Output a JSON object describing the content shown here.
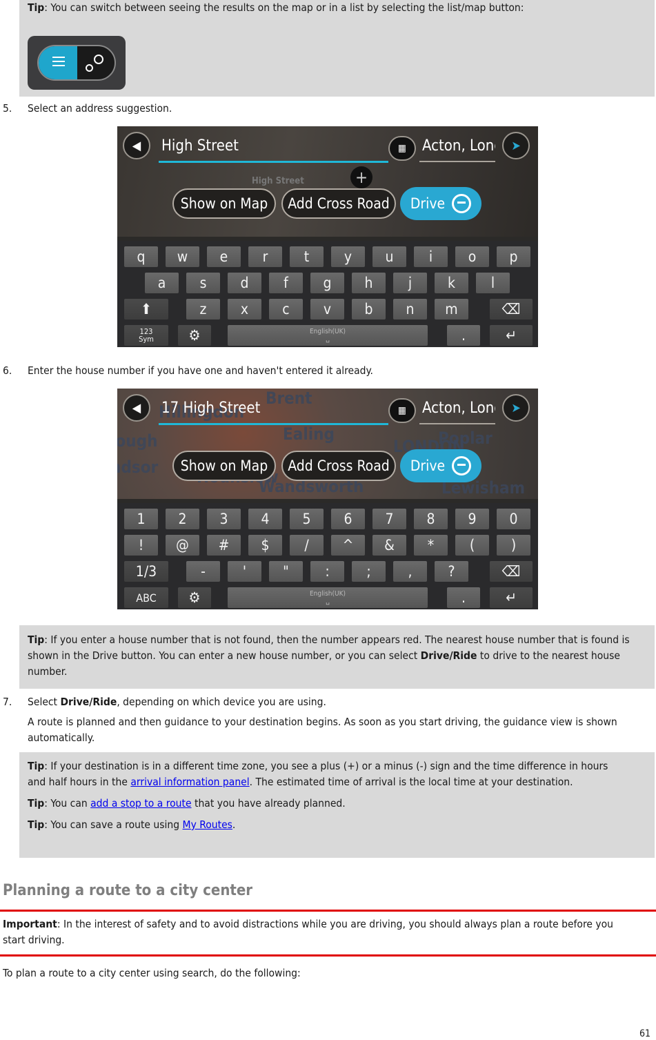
{
  "tip_top": {
    "label": "Tip",
    "text": ": You can switch between seeing the results on the map or in a list by selecting the list/map button:",
    "button_icons": [
      "list-icon",
      "map-pins-icon"
    ]
  },
  "step5": {
    "number": "5.",
    "text": "Select an address suggestion."
  },
  "screen1": {
    "query": "High Street",
    "city": "Acton, Lond",
    "map_label": "High Street",
    "buttons": {
      "show_on_map": "Show on Map",
      "add_cross_road": "Add Cross Road",
      "drive": "Drive"
    },
    "keyboard": {
      "row1": [
        "q",
        "w",
        "e",
        "r",
        "t",
        "y",
        "u",
        "i",
        "o",
        "p"
      ],
      "row2": [
        "a",
        "s",
        "d",
        "f",
        "g",
        "h",
        "j",
        "k",
        "l"
      ],
      "row3": [
        "z",
        "x",
        "c",
        "v",
        "b",
        "n",
        "m"
      ],
      "sym_label_1": "123",
      "sym_label_2": "Sym",
      "space_label": "English(UK)",
      "period": "."
    }
  },
  "step6": {
    "number": "6.",
    "text": "Enter the house number if you have one and haven't entered it already."
  },
  "screen2": {
    "query": "17 High Street",
    "city": "Acton, Londo",
    "map_labels": [
      "Brent",
      "Hillingdon",
      "Ealing",
      "LONDON",
      "Poplar",
      "lough",
      "ndsor",
      "Hounslow",
      "Wandsworth",
      "Lewisham"
    ],
    "buttons": {
      "show_on_map": "Show on Map",
      "add_cross_road": "Add Cross Road",
      "drive": "Drive"
    },
    "keyboard": {
      "row1": [
        "1",
        "2",
        "3",
        "4",
        "5",
        "6",
        "7",
        "8",
        "9",
        "0"
      ],
      "row2": [
        "!",
        "@",
        "#",
        "$",
        "/",
        "^",
        "&",
        "*",
        "(",
        ")"
      ],
      "row3": [
        "-",
        "'",
        "\"",
        ":",
        ";",
        ",",
        "?"
      ],
      "page_label": "1/3",
      "abc_label": "ABC",
      "space_label": "English(UK)",
      "period": "."
    }
  },
  "tip_house": {
    "label": "Tip",
    "text_before": ": If you enter a house number that is not found, then the number appears red. The nearest house number that is found is shown in the Drive button. You can enter a new house number, or you can select ",
    "bold": "Drive/Ride",
    "text_after": " to drive to the nearest house number."
  },
  "step7": {
    "number": "7.",
    "text_before": "Select ",
    "bold": "Drive/Ride",
    "text_after": ", depending on which device you are using.",
    "para": "A route is planned and then guidance to your destination begins. As soon as you start driving, the guidance view is shown automatically."
  },
  "tips_route": [
    {
      "label": "Tip",
      "before": ": If your destination is in a different time zone, you see a plus (+) or a minus (-) sign and the time difference in hours and half hours in the ",
      "link": "arrival information panel",
      "after": ". The estimated time of arrival is the local time at your destination."
    },
    {
      "label": "Tip",
      "before": ": You can ",
      "link": "add a stop to a route",
      "after": " that you have already planned."
    },
    {
      "label": "Tip",
      "before": ": You can save a route using ",
      "link": "My Routes",
      "after": "."
    }
  ],
  "section": {
    "heading": "Planning a route to a city center",
    "important_label": "Important",
    "important_text": ": In the interest of safety and to avoid distractions while you are driving, you should always plan a route before you start driving.",
    "intro": "To plan a route to a city center using search, do the following:"
  },
  "page_number": "61",
  "colors": {
    "accent": "#29a8d2",
    "tip_bg": "#d9d9d9",
    "heading": "#7f7f7f",
    "rule": "#e00000",
    "link": "#0000ee"
  }
}
